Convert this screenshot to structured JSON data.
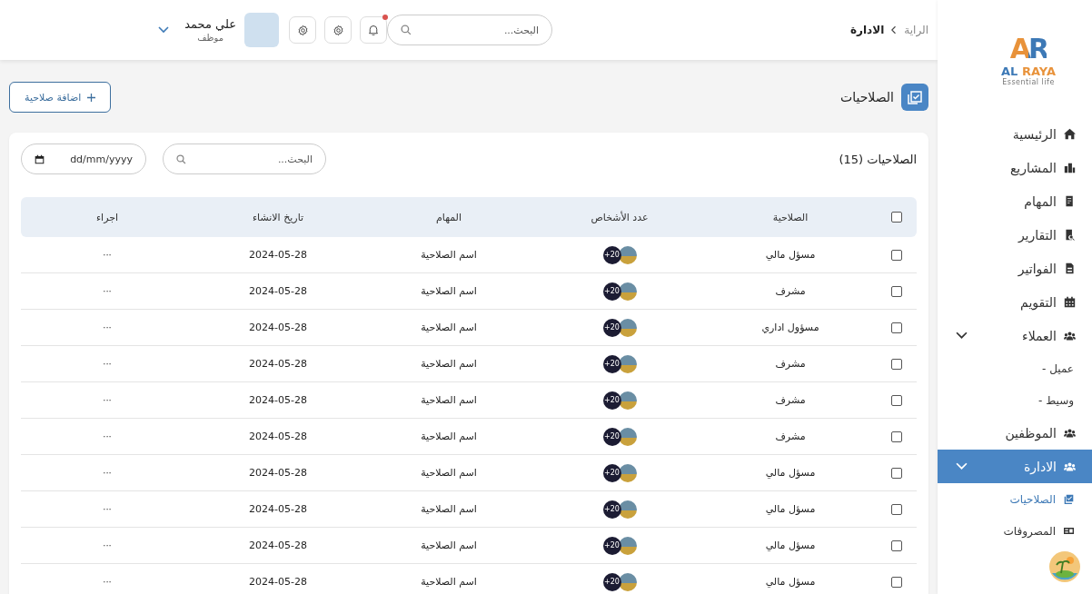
{
  "logo": {
    "mark": "AR",
    "name": "AL RAYA",
    "tagline": "Essential life"
  },
  "sidebar": {
    "items": [
      {
        "label": "الرئيسية",
        "selected": false
      },
      {
        "label": "المشاريع",
        "selected": false
      },
      {
        "label": "المهام",
        "selected": false
      },
      {
        "label": "التقارير",
        "selected": false
      },
      {
        "label": "الفواتير",
        "selected": false
      },
      {
        "label": "التقويم",
        "selected": false
      },
      {
        "label": "العملاء",
        "selected": false,
        "expanded": true,
        "children": [
          {
            "label": "- عميل",
            "kind": "dash",
            "selected": false
          },
          {
            "label": "- وسيط",
            "kind": "dash",
            "selected": false
          }
        ]
      },
      {
        "label": "الموظفين",
        "selected": false
      },
      {
        "label": "الادارة",
        "selected": true,
        "expanded": true,
        "children": [
          {
            "label": "الصلاحيات",
            "kind": "icon",
            "selected": true
          },
          {
            "label": "المصروفات",
            "kind": "icon",
            "selected": false
          }
        ]
      }
    ]
  },
  "header": {
    "breadcrumb": [
      "الراية",
      "الادارة"
    ],
    "search": {
      "placeholder": "البحث..."
    },
    "notifications": {
      "unread": true
    },
    "user": {
      "name": "علي محمد",
      "role": "موظف"
    }
  },
  "page": {
    "title": "الصلاحيات",
    "add_button": "اضافة صلاحية"
  },
  "card": {
    "title": "الصلاحيات (15)",
    "search": {
      "placeholder": "البحث..."
    },
    "date": {
      "placeholder": "dd/mm/yyyy"
    }
  },
  "table": {
    "header_checked": false,
    "columns": [
      "الصلاحية",
      "عدد الأشخاص",
      "المهام",
      "تاريخ الانشاء",
      "اجراء"
    ],
    "rows": [
      {
        "checked": false,
        "role": "مسؤل مالي",
        "people": "20+",
        "task": "اسم الصلاحية",
        "date": "2024-05-28",
        "action": "···"
      },
      {
        "checked": false,
        "role": "مشرف",
        "people": "20+",
        "task": "اسم الصلاحية",
        "date": "2024-05-28",
        "action": "···"
      },
      {
        "checked": false,
        "role": "مسؤول اداري",
        "people": "20+",
        "task": "اسم الصلاحية",
        "date": "2024-05-28",
        "action": "···"
      },
      {
        "checked": false,
        "role": "مشرف",
        "people": "20+",
        "task": "اسم الصلاحية",
        "date": "2024-05-28",
        "action": "···"
      },
      {
        "checked": false,
        "role": "مشرف",
        "people": "20+",
        "task": "اسم الصلاحية",
        "date": "2024-05-28",
        "action": "···"
      },
      {
        "checked": false,
        "role": "مشرف",
        "people": "20+",
        "task": "اسم الصلاحية",
        "date": "2024-05-28",
        "action": "···"
      },
      {
        "checked": false,
        "role": "مسؤل مالي",
        "people": "20+",
        "task": "اسم الصلاحية",
        "date": "2024-05-28",
        "action": "···"
      },
      {
        "checked": false,
        "role": "مسؤل مالي",
        "people": "20+",
        "task": "اسم الصلاحية",
        "date": "2024-05-28",
        "action": "···"
      },
      {
        "checked": false,
        "role": "مسؤل مالي",
        "people": "20+",
        "task": "اسم الصلاحية",
        "date": "2024-05-28",
        "action": "···"
      },
      {
        "checked": false,
        "role": "مسؤل مالي",
        "people": "20+",
        "task": "اسم الصلاحية",
        "date": "2024-05-28",
        "action": "···"
      }
    ]
  }
}
